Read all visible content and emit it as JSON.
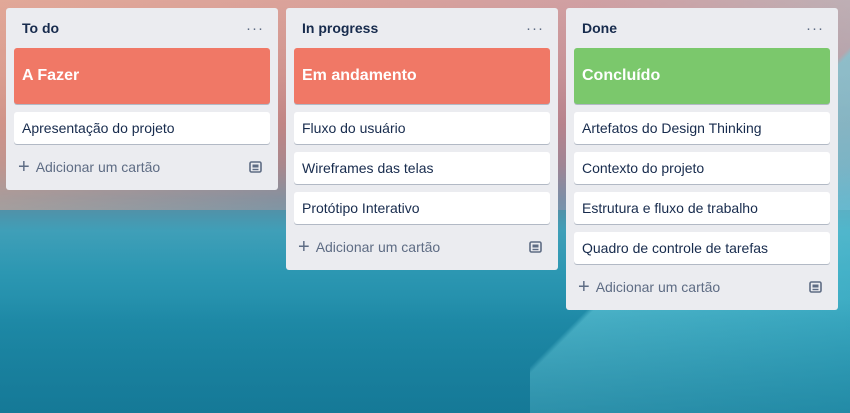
{
  "lists": [
    {
      "title": "To do",
      "menu": "···",
      "cover": {
        "label": "A Fazer",
        "color": "#f07866"
      },
      "cards": [
        "Apresentação do projeto"
      ],
      "add_label": "Adicionar um cartão"
    },
    {
      "title": "In progress",
      "menu": "···",
      "cover": {
        "label": "Em andamento",
        "color": "#f07866"
      },
      "cards": [
        "Fluxo do usuário",
        "Wireframes das telas",
        "Protótipo Interativo"
      ],
      "add_label": "Adicionar um cartão"
    },
    {
      "title": "Done",
      "menu": "···",
      "cover": {
        "label": "Concluído",
        "color": "#7bc86c"
      },
      "cards": [
        "Artefatos do Design Thinking",
        "Contexto do projeto",
        "Estrutura e fluxo de trabalho",
        "Quadro de controle de tarefas"
      ],
      "add_label": "Adicionar um cartão"
    }
  ],
  "icons": {
    "add": "plus-icon",
    "template": "card-template-icon",
    "menu": "more-horizontal-icon"
  }
}
